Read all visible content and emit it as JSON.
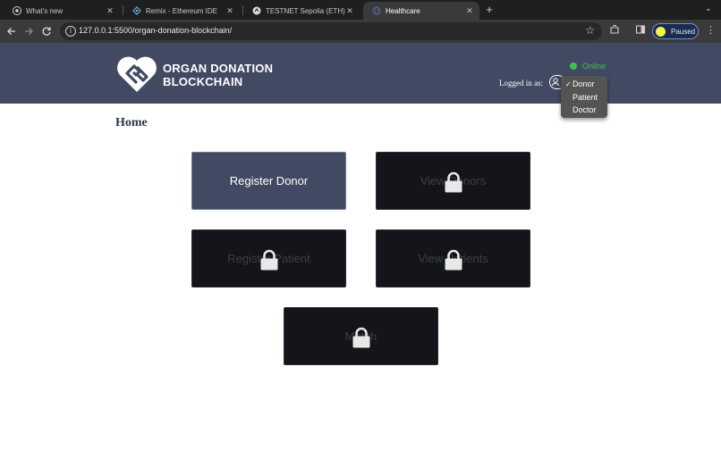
{
  "browser": {
    "tabs": [
      {
        "title": "What's new",
        "favicon": "chrome-icon",
        "active": false
      },
      {
        "title": "Remix - Ethereum IDE",
        "favicon": "remix-icon",
        "active": false
      },
      {
        "title": "TESTNET Sepolia (ETH) Block",
        "favicon": "etherscan-icon",
        "active": false
      },
      {
        "title": "Healthcare",
        "favicon": "globe-icon",
        "active": true
      }
    ],
    "close_glyph": "✕",
    "new_tab_glyph": "+",
    "url": "127.0.0.1:5500/organ-donation-blockchain/",
    "profile_label": "Paused"
  },
  "header": {
    "brand_line1": "ORGAN DONATION",
    "brand_line2": "BLOCKCHAIN",
    "status": "Online",
    "logged_in_label": "Logged in as:",
    "roles": [
      {
        "label": "Donor",
        "selected": true
      },
      {
        "label": "Patient",
        "selected": false
      },
      {
        "label": "Doctor",
        "selected": false
      }
    ],
    "check_glyph": "✓"
  },
  "main": {
    "title": "Home",
    "tiles": [
      {
        "label": "Register Donor",
        "locked": false
      },
      {
        "label": "View Donors",
        "locked": true
      },
      {
        "label": "Register Patient",
        "locked": true
      },
      {
        "label": "View Patients",
        "locked": true
      },
      {
        "label": "Match",
        "locked": true
      }
    ]
  },
  "colors": {
    "header_bg": "#414a62",
    "online_green": "#3fc24e",
    "tile_dark": "#14151a",
    "tile_active": "#414a62"
  }
}
